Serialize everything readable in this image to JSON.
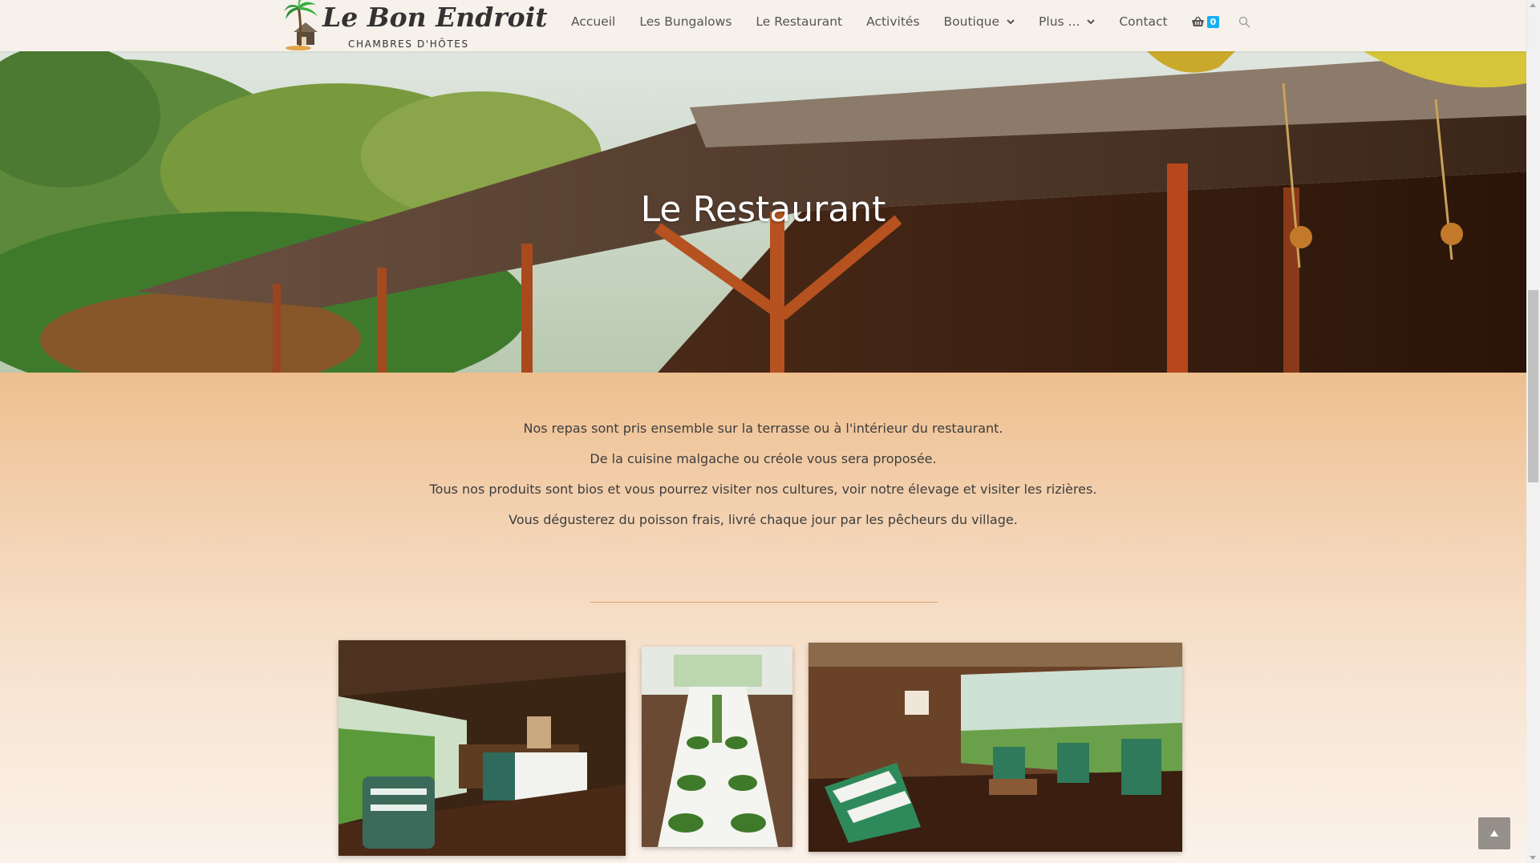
{
  "site": {
    "logo_title": "Le Bon Endroit",
    "logo_subtitle": "CHAMBRES D'HÔTES"
  },
  "nav": {
    "items": [
      {
        "label": "Accueil",
        "dropdown": false
      },
      {
        "label": "Les Bungalows",
        "dropdown": false
      },
      {
        "label": "Le Restaurant",
        "dropdown": false
      },
      {
        "label": "Activités",
        "dropdown": false
      },
      {
        "label": "Boutique",
        "dropdown": true
      },
      {
        "label": "Plus ...",
        "dropdown": true
      },
      {
        "label": "Contact",
        "dropdown": false
      }
    ],
    "cart_icon": "basket-icon",
    "cart_count": "0",
    "search_icon": "search-icon"
  },
  "hero": {
    "title": "Le Restaurant"
  },
  "content": {
    "paragraphs": [
      "Nos repas sont pris ensemble sur la terrasse ou à l'intérieur du restaurant.",
      "De la cuisine malgache ou créole vous sera proposée.",
      "Tous nos produits sont bios et vous pourrez visiter nos cultures, voir notre élevage et visiter les rizières.",
      "Vous dégusterez du poisson frais, livré chaque jour par les pêcheurs du village."
    ]
  },
  "gallery": {
    "photos": [
      "restaurant-terrace-photo",
      "dining-table-photo",
      "lounge-deckchairs-photo"
    ]
  },
  "colors": {
    "accent": "#13aff0",
    "divider": "#d8a36d",
    "content_bg_top": "#eebf8e"
  },
  "back_to_top_icon": "chevron-up-icon"
}
